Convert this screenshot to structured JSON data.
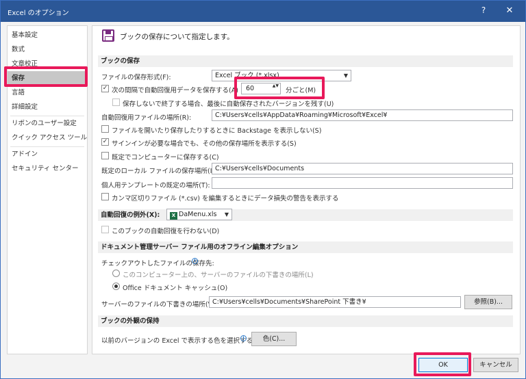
{
  "window": {
    "title": "Excel のオプション",
    "help": "?",
    "close": "✕"
  },
  "sidebar": {
    "items": [
      "基本設定",
      "数式",
      "文章校正",
      "保存",
      "言語",
      "詳細設定",
      "リボンのユーザー設定",
      "クイック アクセス ツール バー",
      "アドイン",
      "セキュリティ センター"
    ],
    "active": "保存"
  },
  "header": {
    "text": "ブックの保存について指定します。"
  },
  "save_section": {
    "title": "ブックの保存",
    "format_label": "ファイルの保存形式(F):",
    "format_value": "Excel ブック (*.xlsx)",
    "autorecover_label": "次の間隔で自動回復用データを保存する(A)",
    "autorecover_minutes": "60",
    "minutes_unit": "分ごと(M)",
    "keep_last_label": "保存しないで終了する場合、最後に自動保存されたバージョンを残す(U)",
    "autorecover_location_label": "自動回復用ファイルの場所(R):",
    "autorecover_location_value": "C:¥Users¥cells¥AppData¥Roaming¥Microsoft¥Excel¥",
    "backstage_label": "ファイルを開いたり保存したりするときに Backstage を表示しない(S)",
    "signin_label": "サインインが必要な場合でも、その他の保存場所を表示する(S)",
    "save_computer_label": "既定でコンピューターに保存する(C)",
    "default_local_label": "既定のローカル ファイルの保存場所(I):",
    "default_local_value": "C:¥Users¥cells¥Documents",
    "personal_template_label": "個人用テンプレートの既定の場所(T):",
    "personal_template_value": "",
    "csv_warning_label": "カンマ区切りファイル (*.csv) を編集するときにデータ損失の警告を表示する"
  },
  "exceptions": {
    "title": "自動回復の例外(X):",
    "workbook": "DaMenu.xls",
    "xls_icon": "X",
    "disable_label": "このブックの自動回復を行わない(D)"
  },
  "offline": {
    "title": "ドキュメント管理サーバー ファイル用のオフライン編集オプション",
    "checkout_label": "チェックアウトしたファイルの保存先:",
    "option1": "このコンピューター上の、サーバーのファイルの下書きの場所(L)",
    "option2": "Office ドキュメント キャッシュ(O)",
    "drafts_label": "サーバーのファイルの下書きの場所(V):",
    "drafts_value": "C:¥Users¥cells¥Documents¥SharePoint 下書き¥",
    "browse_label": "参照(B)..."
  },
  "appearance": {
    "title": "ブックの外観の保持",
    "color_label": "以前のバージョンの Excel で表示する色を選択する:",
    "color_button": "色(C)..."
  },
  "footer": {
    "ok": "OK",
    "cancel": "キャンセル"
  },
  "glyphs": {
    "check": "✓",
    "arrow_down": "▼",
    "spin": "▲▼",
    "info": "i"
  },
  "colors": {
    "titlebar": "#2b5797",
    "highlight": "#e8195a",
    "active_nav": "#c7c7c7"
  }
}
